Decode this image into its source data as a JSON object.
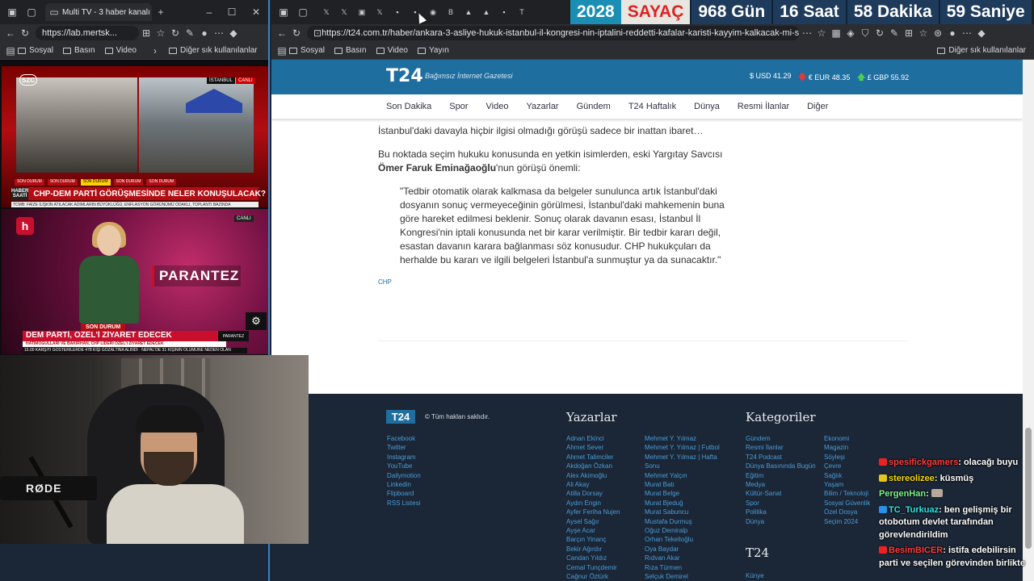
{
  "left_browser": {
    "tab_title": "Multi TV - 3 haber kanalı",
    "url": "https://lab.mertsk...",
    "favorites": [
      "Sosyal",
      "Basın",
      "Video"
    ],
    "favorites_other": "Diğer sık kullanılanlar"
  },
  "tv_panel1": {
    "channel_logo": "SZC",
    "location": "İSTANBUL",
    "live": "CANLI",
    "segment_label": "HABER SAATİ",
    "strip_items": [
      "SON DURUM",
      "SON DURUM",
      "SON DURUM",
      "SON DURUM",
      "SON DURUM"
    ],
    "headline": "CHP-DEM PARTİ GÖRÜŞMESİNDE NELER KONUŞULACAK?",
    "ticker": "TCMB: FAİZE İLİŞKİN ATILACAK ADIMLARIN BÜYÜKLÜĞÜ, ENFLASYON GÖRÜNÜMÜ ODAKLI, TOPLANTI BAZINDA"
  },
  "tv_panel2": {
    "channel_logo": "h",
    "live": "CANLI",
    "program": "PARANTEZ",
    "son_durum": "SON DURUM",
    "headline": "DEM PARTİ, ÖZEL'İ ZİYARET EDECEK",
    "subline": "HATİMOĞULLARI VE BAKIRHAN, CHP LİDERİ ÖZEL'İ ZİYARET EDECEK",
    "program_box": "PARANTEZ",
    "ticker": "15.00 KARŞITI GÖSTERİLERDE 478 KİŞİ GÖZALTINA ALINDI · NEPAL'DE 31 KİŞİNİN ÖLÜMÜNE NEDEN OLAN"
  },
  "webcam": {
    "mic_brand": "RØDE"
  },
  "right_browser": {
    "countdown": {
      "year": "2028",
      "title": "SAYAÇ",
      "days": "968 Gün",
      "hours": "16 Saat",
      "minutes": "58 Dakika",
      "seconds": "59 Saniye"
    },
    "url": "https://t24.com.tr/haber/ankara-3-asliye-hukuk-istanbul-il-kongresi-nin-iptalini-reddetti-kafalar-karisti-kayyim-kalkacak-mi-simdi-ne-ol...",
    "favorites": [
      "Sosyal",
      "Basın",
      "Video",
      "Yayın"
    ],
    "favorites_other": "Diğer sık kullanılanlar"
  },
  "t24": {
    "logo": "T24",
    "tagline": "Bağımsız İnternet Gazetesi",
    "usd": "USD 41.29",
    "eur": "EUR 48.35",
    "gbp": "GBP 55.92",
    "nav": [
      "Son Dakika",
      "Spor",
      "Video",
      "Yazarlar",
      "Gündem",
      "T24 Haftalık",
      "Dünya",
      "Resmi İlanlar",
      "Diğer"
    ]
  },
  "article": {
    "p1": "İstanbul'daki davayla hiçbir ilgisi olmadığı görüşü sadece bir inattan ibaret…",
    "p2_pre": "Bu noktada seçim hukuku konusunda en yetkin isimlerden, eski Yargıtay Savcısı",
    "p2_name": "Ömer Faruk Eminağaoğlu",
    "p2_post": "'nun görüşü önemli:",
    "quote": "\"Tedbir otomatik olarak kalkmasa da belgeler sunulunca artık İstanbul'daki dosyanın sonuç vermeyeceğinin görülmesi, İstanbul'daki mahkemenin buna göre hareket edilmesi beklenir. Sonuç olarak davanın esası, İstanbul İl Kongresi'nin iptali konusunda net bir karar verilmiştir. Bir tedbir kararı değil, esastan davanın karara bağlanması söz konusudur. CHP hukukçuları da herhalde bu kararı ve ilgili belgeleri İstanbul'a sunmuştur ya da sunacaktır.\"",
    "tag": "CHP"
  },
  "footer": {
    "logo": "T24",
    "copyright": "© Tüm hakları saklıdır.",
    "social": [
      "Facebook",
      "Twitter",
      "Instagram",
      "YouTube",
      "Dailymotion",
      "Linkedin",
      "Flipboard",
      "RSS Listesi"
    ],
    "yazarlar_title": "Yazarlar",
    "yazarlar_col1": [
      "Adnan Ekinci",
      "Ahmet Sever",
      "Ahmet Talimciler",
      "Akdoğan Özkan",
      "Alex Akimoğlu",
      "Ali Akay",
      "Atilla Dorsay",
      "Aydın Engin",
      "Ayfer Feriha Nujen",
      "Aysel Sağır",
      "Ayşe Acar",
      "Barçın Yinanç",
      "Bekir Ağırdır",
      "Candan Yıldız",
      "Cemal Tunçdemir",
      "Cağnur Öztürk"
    ],
    "yazarlar_col2": [
      "Mehmet Y. Yılmaz",
      "Mehmet Y. Yılmaz | Futbol",
      "Mehmet Y. Yılmaz | Hafta",
      "Sonu",
      "Mehmet Yalçın",
      "Murat Batı",
      "Murat Belge",
      "Murat Bjeduğ",
      "Murat Sabuncu",
      "Mustafa Durmuş",
      "Oğuz Demiralp",
      "Orhan Tekelioğlu",
      "Oya Baydar",
      "Rıdvan Akar",
      "Rıza Türmen",
      "Selçuk Demirel"
    ],
    "kategoriler_title": "Kategoriler",
    "kategoriler_col1": [
      "Gündem",
      "Resmi İlanlar",
      "T24 Podcast",
      "Dünya Basınında Bugün",
      "Eğitim",
      "Medya",
      "Kültür-Sanat",
      "Spor",
      "Politika",
      "Dünya"
    ],
    "kategoriler_col2": [
      "Ekonomi",
      "Magazin",
      "Söyleşi",
      "Çevre",
      "Sağlık",
      "Yaşam",
      "Bilim / Teknoloji",
      "Sosyal Güvenlik",
      "Özel Dosya",
      "Seçim 2024"
    ],
    "t24_title": "T24",
    "t24_links": [
      "Künye"
    ]
  },
  "chat": [
    {
      "user": "spesifickgamers",
      "user_color": "#ff3b3b",
      "badge": "red",
      "msg": "olacağı buyu"
    },
    {
      "user": "stereolizee",
      "user_color": "#f5d90a",
      "badge": "yellow",
      "msg": "küsmüş"
    },
    {
      "user": "PergenHan",
      "user_color": "#7cf58a",
      "badge": "",
      "msg": "",
      "emote": true
    },
    {
      "user": "TC_Turkuaz",
      "user_color": "#2ee6e6",
      "badge": "blue",
      "msg": "ben gelişmiş bir otobotum devlet tarafından görevlendirildim"
    },
    {
      "user": "BesimBICER",
      "user_color": "#ff3b3b",
      "badge": "red",
      "msg": "istifa edebilirsin parti ve seçilen görevinden birlikte"
    }
  ]
}
